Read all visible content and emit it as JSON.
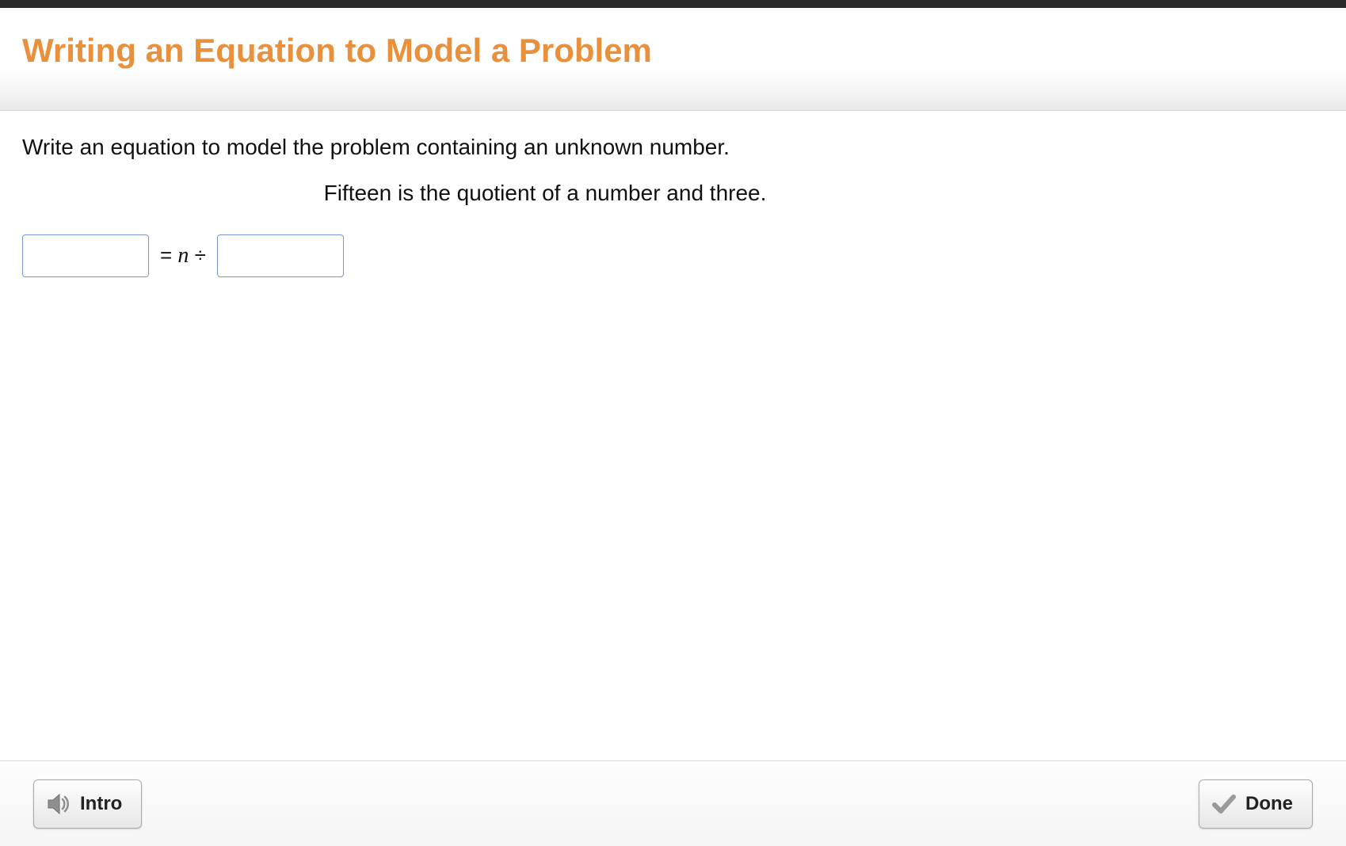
{
  "header": {
    "title": "Writing an Equation to Model a Problem"
  },
  "content": {
    "prompt": "Write an equation to model the problem containing an unknown number.",
    "statement": "Fifteen is the quotient of a number and three.",
    "equation": {
      "left_value": "",
      "middle_text": "= n ÷",
      "right_value": ""
    }
  },
  "footer": {
    "intro_label": "Intro",
    "done_label": "Done"
  }
}
